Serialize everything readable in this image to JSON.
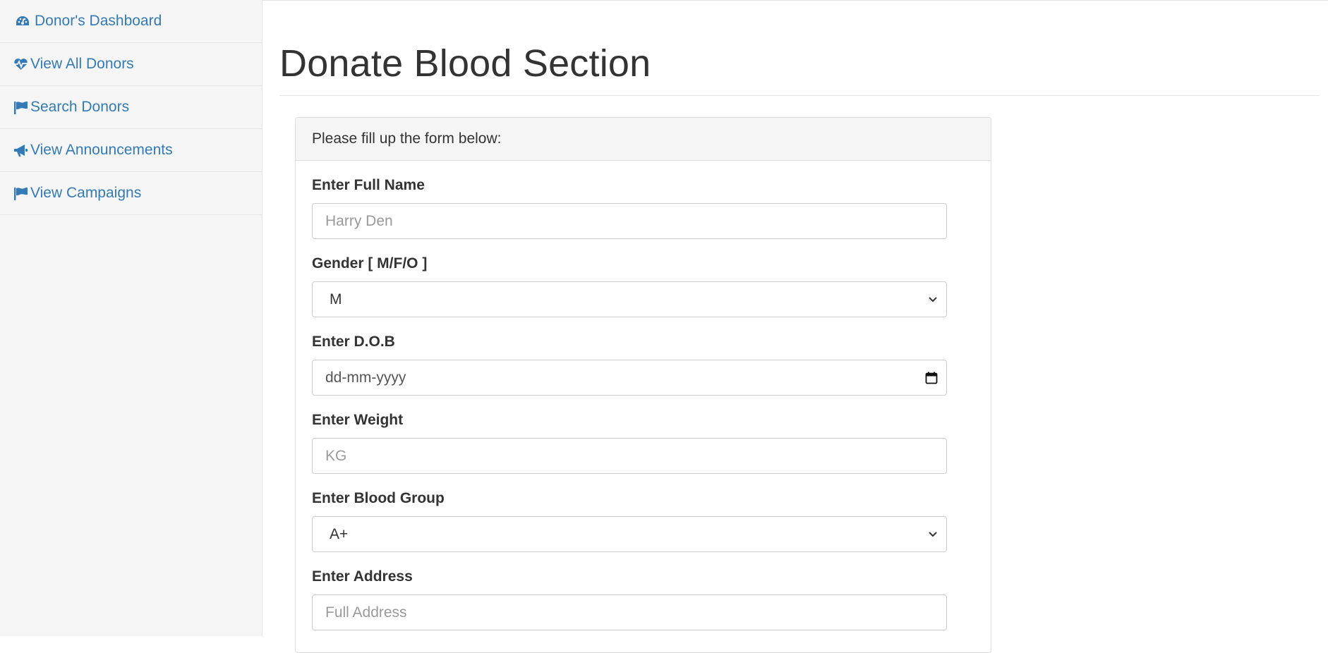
{
  "sidebar": {
    "items": [
      {
        "label": "Donor's Dashboard",
        "icon": "dashboard-icon"
      },
      {
        "label": "View All Donors",
        "icon": "heartbeat-icon"
      },
      {
        "label": "Search Donors",
        "icon": "flag-icon"
      },
      {
        "label": "View Announcements",
        "icon": "bullhorn-icon"
      },
      {
        "label": "View Campaigns",
        "icon": "flag-icon"
      }
    ]
  },
  "main": {
    "title": "Donate Blood Section",
    "panel": {
      "heading": "Please fill up the form below:",
      "fields": {
        "full_name": {
          "label": "Enter Full Name",
          "placeholder": "Harry Den"
        },
        "gender": {
          "label": "Gender [ M/F/O ]",
          "value": "M"
        },
        "dob": {
          "label": "Enter D.O.B",
          "placeholder": "dd-mm-yyyy"
        },
        "weight": {
          "label": "Enter Weight",
          "placeholder": "KG"
        },
        "blood_group": {
          "label": "Enter Blood Group",
          "value": "A+"
        },
        "address": {
          "label": "Enter Address",
          "placeholder": "Full Address"
        }
      }
    }
  },
  "colors": {
    "link": "#337ab7",
    "sidebar_bg": "#f5f5f5",
    "panel_heading_bg": "#f5f5f5",
    "text": "#333333"
  }
}
